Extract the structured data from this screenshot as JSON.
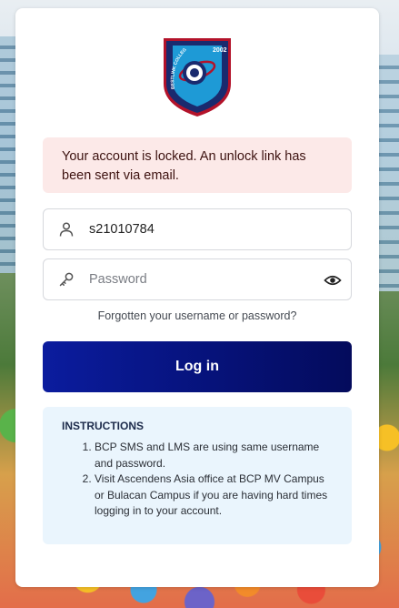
{
  "logo": {
    "year": "2002",
    "arc_text": "BESTLINK COLLEGE OF THE PHILIPPINES",
    "colors": {
      "shield": "#1e9ad6",
      "border": "#b3122a",
      "navy": "#1a2a6e"
    }
  },
  "alert": {
    "message": "Your account is locked. An unlock link has been sent via email."
  },
  "form": {
    "username_value": "s21010784",
    "username_icon": "user-icon",
    "password_placeholder": "Password",
    "password_icon": "key-icon",
    "toggle_icon": "eye-icon",
    "forgot_link": "Forgotten your username or password?",
    "login_label": "Log in"
  },
  "instructions": {
    "title": "INSTRUCTIONS",
    "items": [
      "BCP SMS and LMS are using same username and password.",
      "Visit Ascendens Asia office at BCP MV Campus or Bulacan Campus if you are having hard times logging in to your account."
    ]
  },
  "colors": {
    "primary": "#0b1c9e",
    "alert_bg": "#fce9e8",
    "info_bg": "#eaf5fd"
  }
}
